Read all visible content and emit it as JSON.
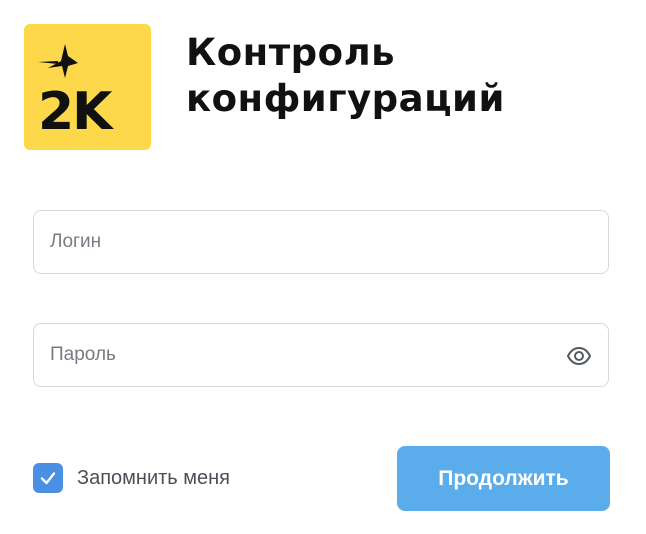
{
  "logo": {
    "text": "2K",
    "icon": "star-icon",
    "background_color": "#fcd84a"
  },
  "title": {
    "line1": "Контроль",
    "line2": "конфигураций"
  },
  "form": {
    "login": {
      "placeholder": "Логин",
      "value": ""
    },
    "password": {
      "placeholder": "Пароль",
      "value": "",
      "toggle_icon": "eye-icon"
    },
    "remember": {
      "label": "Запомнить меня",
      "checked": true,
      "icon": "checkmark-icon"
    },
    "submit_label": "Продолжить"
  },
  "colors": {
    "accent": "#5aacea",
    "checkbox": "#4a8fe4",
    "text": "#111111"
  }
}
